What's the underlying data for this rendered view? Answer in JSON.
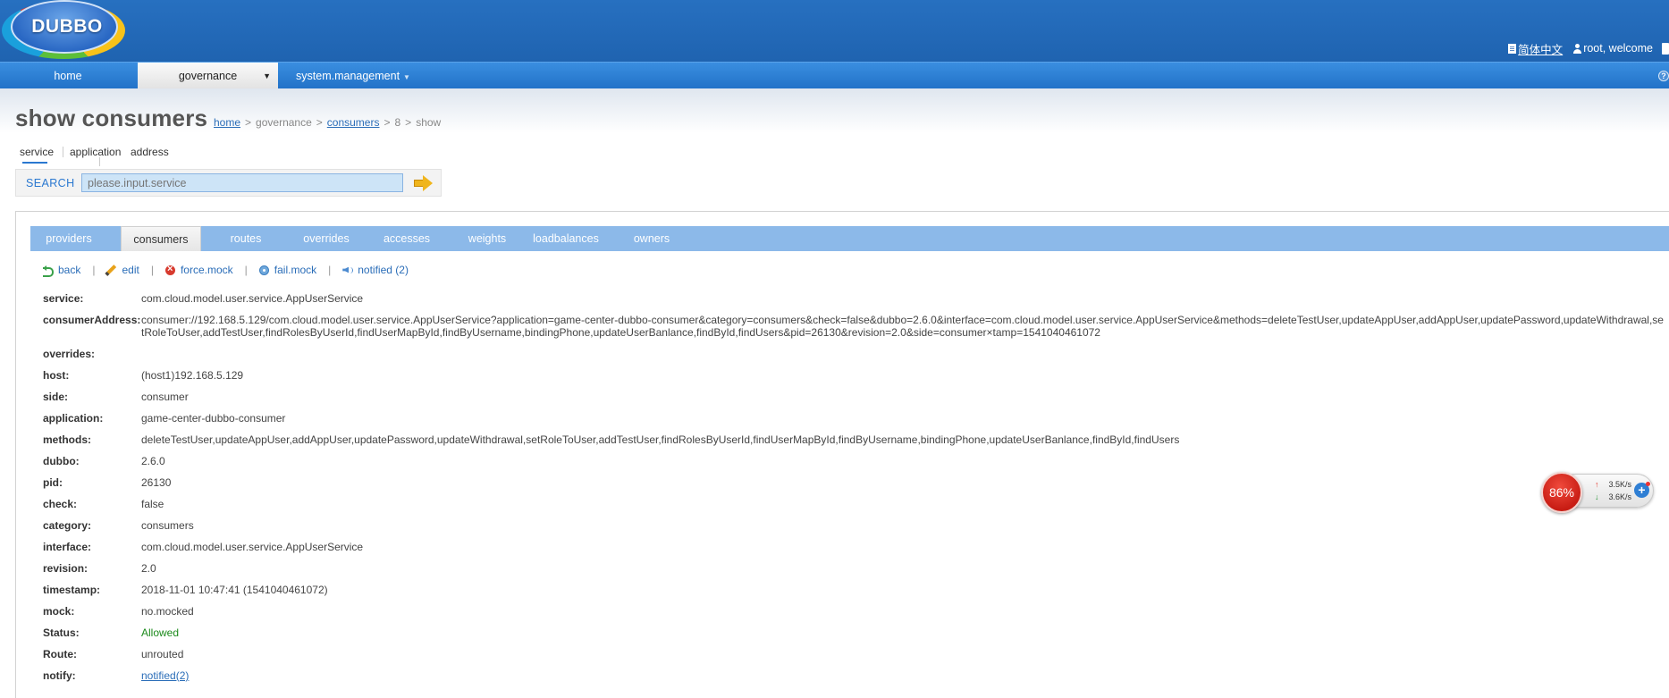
{
  "app": {
    "logo_text": "DUBBO"
  },
  "user_area": {
    "language": "简体中文",
    "welcome": "root, welcome"
  },
  "nav": {
    "home": "home",
    "governance": "governance",
    "system_management": "system.management"
  },
  "page": {
    "title": "show consumers",
    "breadcrumb": {
      "home": "home",
      "governance": "governance",
      "consumers": "consumers",
      "id": "8",
      "action": "show",
      "separator": ">"
    }
  },
  "search": {
    "types": [
      "service",
      "application",
      "address"
    ],
    "active_type": "service",
    "label": "SEARCH",
    "placeholder": "please.input.service"
  },
  "tabs": [
    "providers",
    "consumers",
    "routes",
    "overrides",
    "accesses",
    "weights",
    "loadbalances",
    "owners"
  ],
  "active_tab": "consumers",
  "actions": {
    "back": "back",
    "edit": "edit",
    "force_mock": "force.mock",
    "fail_mock": "fail.mock",
    "notified": "notified (2)",
    "separator": "|"
  },
  "details": {
    "service": {
      "label": "service:",
      "value": "com.cloud.model.user.service.AppUserService"
    },
    "consumer_address": {
      "label": "consumerAddress:",
      "value": "consumer://192.168.5.129/com.cloud.model.user.service.AppUserService?application=game-center-dubbo-consumer&category=consumers&check=false&dubbo=2.6.0&interface=com.cloud.model.user.service.AppUserService&methods=deleteTestUser,updateAppUser,addAppUser,updatePassword,updateWithdrawal,setRoleToUser,addTestUser,findRolesByUserId,findUserMapById,findByUsername,bindingPhone,updateUserBanlance,findById,findUsers&pid=26130&revision=2.0&side=consumer×tamp=1541040461072"
    },
    "overrides": {
      "label": "overrides:",
      "value": ""
    },
    "host": {
      "label": "host:",
      "value": "(host1)192.168.5.129"
    },
    "side": {
      "label": "side:",
      "value": "consumer"
    },
    "application": {
      "label": "application:",
      "value": "game-center-dubbo-consumer"
    },
    "methods": {
      "label": "methods:",
      "value": "deleteTestUser,updateAppUser,addAppUser,updatePassword,updateWithdrawal,setRoleToUser,addTestUser,findRolesByUserId,findUserMapById,findByUsername,bindingPhone,updateUserBanlance,findById,findUsers"
    },
    "dubbo": {
      "label": "dubbo:",
      "value": "2.6.0"
    },
    "pid": {
      "label": "pid:",
      "value": "26130"
    },
    "check": {
      "label": "check:",
      "value": "false"
    },
    "category": {
      "label": "category:",
      "value": "consumers"
    },
    "interface": {
      "label": "interface:",
      "value": "com.cloud.model.user.service.AppUserService"
    },
    "revision": {
      "label": "revision:",
      "value": "2.0"
    },
    "timestamp": {
      "label": "timestamp:",
      "value": "2018-11-01 10:47:41 (1541040461072)"
    },
    "mock": {
      "label": "mock:",
      "value": "no.mocked"
    },
    "status": {
      "label": "Status:",
      "value": "Allowed",
      "color": "#1b8a1b"
    },
    "route": {
      "label": "Route:",
      "value": "unrouted"
    },
    "notify": {
      "label": "notify:",
      "value": "notified(2)"
    }
  },
  "speed_widget": {
    "percent": "86%",
    "upload": "3.5K/s",
    "download": "3.6K/s",
    "plus": "+"
  }
}
